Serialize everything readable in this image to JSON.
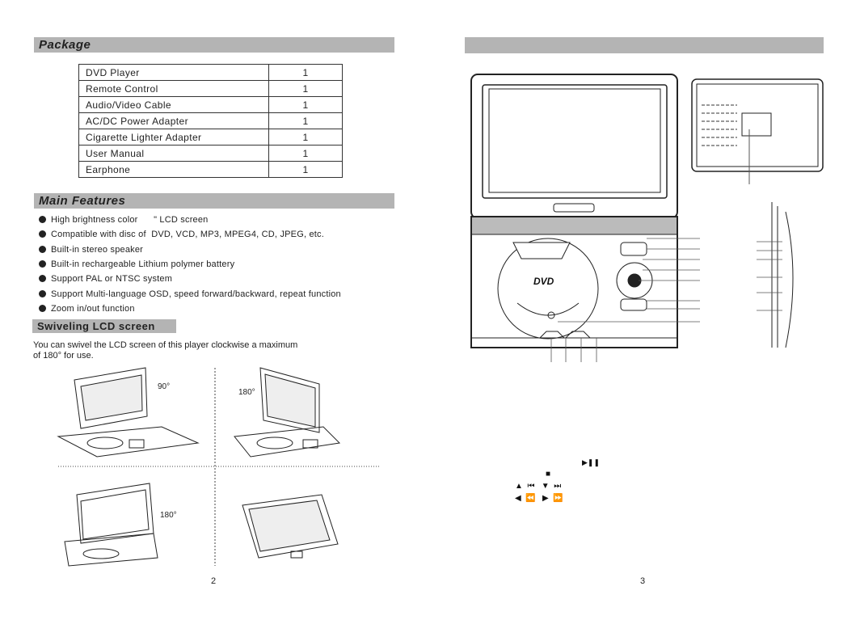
{
  "left_page": {
    "package": {
      "title": "Package",
      "items": [
        {
          "name": "DVD Player",
          "qty": "1"
        },
        {
          "name": "Remote Control",
          "qty": "1"
        },
        {
          "name": "Audio/Video Cable",
          "qty": "1"
        },
        {
          "name": "AC/DC Power Adapter",
          "qty": "1"
        },
        {
          "name": "Cigarette Lighter Adapter",
          "qty": "1"
        },
        {
          "name": "User Manual",
          "qty": "1"
        },
        {
          "name": "Earphone",
          "qty": "1"
        }
      ]
    },
    "features": {
      "title": "Main Features",
      "items": [
        "High brightness color      \" LCD screen",
        "Compatible with disc of  DVD, VCD, MP3, MPEG4, CD, JPEG, etc.",
        "Built-in stereo speaker",
        "Built-in rechargeable Lithium polymer battery",
        "Support PAL or NTSC system",
        "Support Multi-language OSD, speed forward/backward, repeat function",
        "Zoom in/out function"
      ]
    },
    "swivel": {
      "title": "Swiveling  LCD screen",
      "line1": "You can swivel the LCD screen of this player clockwise a maximum",
      "line2": "of 180°  for use.",
      "angles": [
        "90°",
        "180°",
        "180°"
      ]
    },
    "page_number": "2"
  },
  "right_page": {
    "header_title": "",
    "symbols": {
      "play_pause": "▶❚❚",
      "stop": "■",
      "row1": "▲  ⏮   ▼  ⏭",
      "row2": "◀  ⏪   ▶  ⏩"
    },
    "dvd_logo": "DVD",
    "page_number": "3"
  }
}
